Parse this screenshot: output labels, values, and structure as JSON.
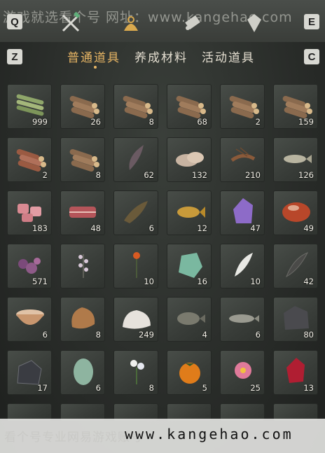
{
  "watermark_top": "游戏就选看个号 网址：www.kangehao.com",
  "keys": {
    "q": "Q",
    "e": "E",
    "z": "Z",
    "c": "C"
  },
  "nav_icons": [
    "crossed-tools-icon",
    "backpack-icon",
    "scroll-icon",
    "gem-icon"
  ],
  "tabs": [
    {
      "label": "普通道具",
      "active": true
    },
    {
      "label": "养成材料",
      "active": false
    },
    {
      "label": "活动道具",
      "active": false
    }
  ],
  "colors": {
    "accent": "#e7b564",
    "slot_bg": "#3f433f"
  },
  "items": [
    {
      "icon": "bamboo-bundle-icon",
      "count": "999"
    },
    {
      "icon": "wood-logs-icon",
      "count": "26"
    },
    {
      "icon": "wood-logs-icon",
      "count": "8"
    },
    {
      "icon": "wood-logs-icon",
      "count": "68"
    },
    {
      "icon": "wood-logs-icon",
      "count": "2"
    },
    {
      "icon": "wood-logs-icon",
      "count": "159"
    },
    {
      "icon": "red-logs-icon",
      "count": "2"
    },
    {
      "icon": "wood-logs-icon",
      "count": "8"
    },
    {
      "icon": "feather-icon",
      "count": "62"
    },
    {
      "icon": "mushroom-icon",
      "count": "132"
    },
    {
      "icon": "shrimp-icon",
      "count": "210"
    },
    {
      "icon": "fish-icon",
      "count": "126"
    },
    {
      "icon": "raw-meat-icon",
      "count": "183"
    },
    {
      "icon": "steak-icon",
      "count": "48"
    },
    {
      "icon": "catfish-icon",
      "count": "6"
    },
    {
      "icon": "carp-icon",
      "count": "12"
    },
    {
      "icon": "amethyst-icon",
      "count": "47"
    },
    {
      "icon": "red-stone-icon",
      "count": "49"
    },
    {
      "icon": "purple-flower-icon",
      "count": "571"
    },
    {
      "icon": "herb-sprig-icon",
      "count": ""
    },
    {
      "icon": "orange-flower-icon",
      "count": "10"
    },
    {
      "icon": "jade-stone-icon",
      "count": "16"
    },
    {
      "icon": "white-feather-icon",
      "count": "10"
    },
    {
      "icon": "dark-feather-icon",
      "count": "42"
    },
    {
      "icon": "clay-bowl-icon",
      "count": "6"
    },
    {
      "icon": "fur-pelt-icon",
      "count": "8"
    },
    {
      "icon": "white-fur-icon",
      "count": "249"
    },
    {
      "icon": "rockfish-icon",
      "count": "4"
    },
    {
      "icon": "grey-fish-icon",
      "count": "6"
    },
    {
      "icon": "ore-icon",
      "count": "80"
    },
    {
      "icon": "dark-ore-icon",
      "count": "17"
    },
    {
      "icon": "green-melon-icon",
      "count": "6"
    },
    {
      "icon": "white-flower-icon",
      "count": "8"
    },
    {
      "icon": "persimmon-icon",
      "count": "5"
    },
    {
      "icon": "pink-flower-icon",
      "count": "25"
    },
    {
      "icon": "red-crystal-icon",
      "count": "13"
    }
  ],
  "watermark_bottom": {
    "cn": "看个号专业网易游戏账号",
    "url": "www.kangehao.com"
  }
}
